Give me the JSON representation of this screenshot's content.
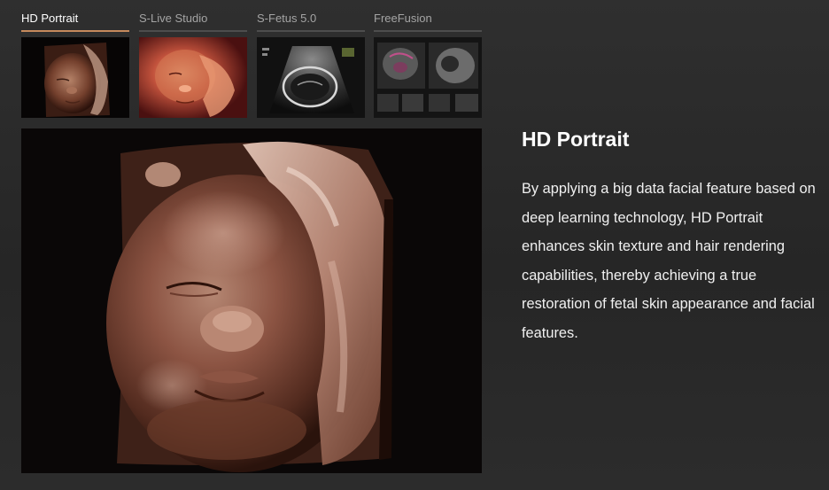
{
  "tabs": [
    {
      "label": "HD Portrait",
      "active": true
    },
    {
      "label": "S-Live Studio",
      "active": false
    },
    {
      "label": "S-Fetus 5.0",
      "active": false
    },
    {
      "label": "FreeFusion",
      "active": false
    }
  ],
  "feature": {
    "title": "HD Portrait",
    "description": "By applying a big data facial feature based on deep learning technology, HD Portrait enhances skin texture and hair rendering capabilities, thereby achieving a true restoration of fetal skin appearance and facial features."
  },
  "colors": {
    "accent": "#c68a5c",
    "background": "#2b2b2b",
    "tab_inactive": "#a4a4a4",
    "tab_active": "#ffffff"
  }
}
